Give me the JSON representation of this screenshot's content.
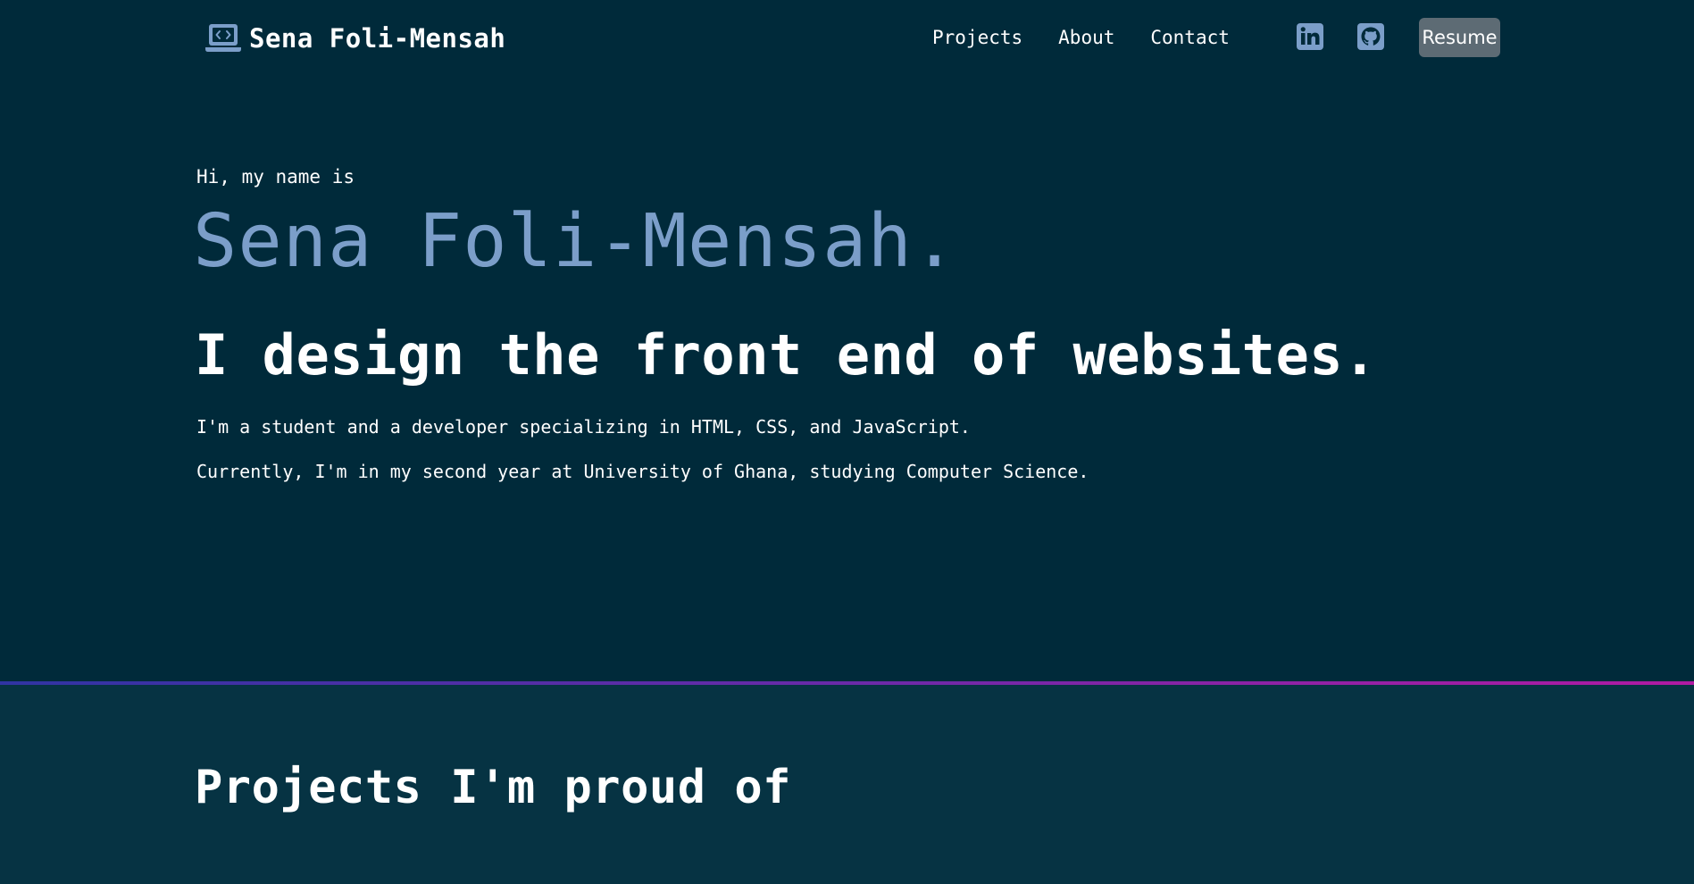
{
  "header": {
    "brand_name": "Sena Foli-Mensah",
    "brand_icon": "laptop-code-icon",
    "nav_links": [
      "Projects",
      "About",
      "Contact"
    ],
    "social_icons": [
      "linkedin-icon",
      "github-icon"
    ],
    "resume_label": "Resume"
  },
  "hero": {
    "greeting": "Hi, my name is",
    "name": "Sena Foli-Mensah.",
    "tagline": "I design the front end of websites.",
    "paragraph_1": "I'm a student and a developer specializing in HTML, CSS, and JavaScript.",
    "paragraph_2": "Currently, I'm in my second year at University of Ghana, studying Computer Science."
  },
  "projects": {
    "title": "Projects I'm proud of"
  },
  "colors": {
    "background": "#002a3a",
    "section_background": "#063343",
    "accent_name": "#7b9ec9",
    "icon_blue": "#7b9ec9",
    "resume_button": "#5d6b74",
    "divider_start": "#3034a3",
    "divider_end": "#b11aa3"
  }
}
